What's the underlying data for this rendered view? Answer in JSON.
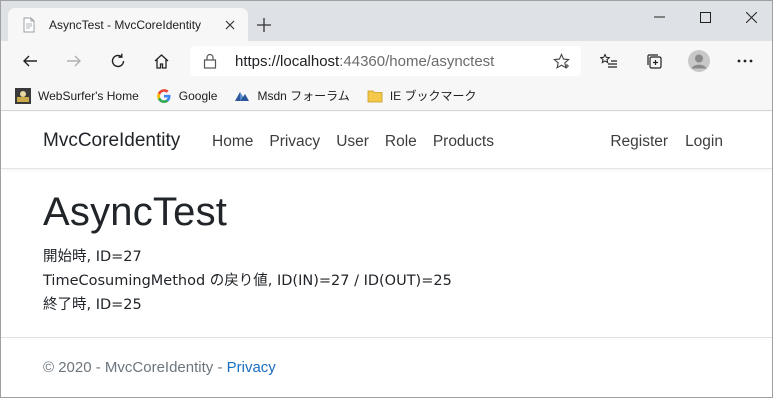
{
  "browser": {
    "tab_title": "AsyncTest - MvcCoreIdentity",
    "url_host": "https://localhost",
    "url_rest": ":44360/home/asynctest",
    "favorites": [
      {
        "label": "WebSurfer's Home",
        "icon": "websurfer-icon"
      },
      {
        "label": "Google",
        "icon": "google-icon"
      },
      {
        "label": "Msdn フォーラム",
        "icon": "msdn-icon"
      },
      {
        "label": "IE ブックマーク",
        "icon": "folder-icon"
      }
    ]
  },
  "navbar": {
    "brand": "MvcCoreIdentity",
    "links": [
      "Home",
      "Privacy",
      "User",
      "Role",
      "Products"
    ],
    "right_links": [
      "Register",
      "Login"
    ]
  },
  "main": {
    "heading": "AsyncTest",
    "lines": [
      "開始時, ID=27",
      "TimeCosumingMethod の戻り値, ID(IN)=27 / ID(OUT)=25",
      "終了時, ID=25"
    ]
  },
  "footer": {
    "text": "© 2020 - MvcCoreIdentity - ",
    "link": "Privacy"
  },
  "colors": {
    "link": "#1b6ec2",
    "titlebar": "#dee1e6",
    "toolbar": "#f7f7f7"
  }
}
